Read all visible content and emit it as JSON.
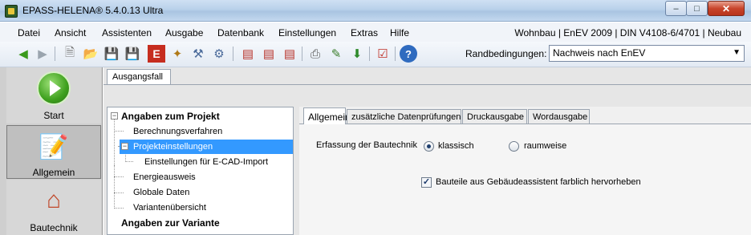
{
  "window": {
    "title": "EPASS-HELENA® 5.4.0.13 Ultra"
  },
  "menu": {
    "items": [
      "Datei",
      "Ansicht",
      "Assistenten",
      "Ausgabe",
      "Datenbank",
      "Einstellungen",
      "Extras",
      "Hilfe"
    ],
    "right_info": "Wohnbau | EnEV 2009 | DIN V4108-6/4701 | Neubau"
  },
  "toolbar": {
    "icons": [
      "back-arrow-icon",
      "forward-arrow-icon",
      "new-document-icon",
      "open-folder-icon",
      "save-icon",
      "save-as-icon",
      "energieausweis-e-icon",
      "wand-icon",
      "tool-icon",
      "gear-icon",
      "chart-icon",
      "chart-edit-icon",
      "chart-bar-icon",
      "print-icon",
      "edit-icon",
      "export-icon",
      "checklist-icon",
      "help-icon"
    ],
    "randbedingungen_label": "Randbedingungen:",
    "randbedingungen_value": "Nachweis nach EnEV"
  },
  "leftnav": {
    "items": [
      {
        "label": "Start",
        "icon": "start-play-icon"
      },
      {
        "label": "Allgemein",
        "icon": "notepad-icon"
      },
      {
        "label": "Bautechnik",
        "icon": "house-icon"
      }
    ]
  },
  "main": {
    "top_tab": "Ausgangsfall",
    "tree": {
      "items": [
        {
          "label": "Angaben zum Projekt",
          "bold": true,
          "expanded": true
        },
        {
          "label": "Berechnungsverfahren"
        },
        {
          "label": "Projekteinstellungen",
          "selected": true,
          "expanded": true
        },
        {
          "label": "Einstellungen für E-CAD-Import"
        },
        {
          "label": "Energieausweis"
        },
        {
          "label": "Globale Daten"
        },
        {
          "label": "Variantenübersicht"
        },
        {
          "label": "Angaben zur Variante",
          "bold": true
        }
      ]
    },
    "panel": {
      "tabs": [
        "Allgemein",
        "zusätzliche Datenprüfungen",
        "Druckausgabe",
        "Wordausgabe"
      ],
      "active_tab": "Allgemein",
      "erfassung_label": "Erfassung der Bautechnik",
      "radio_options": [
        {
          "label": "klassisch",
          "checked": true
        },
        {
          "label": "raumweise",
          "checked": false
        }
      ],
      "checkbox": {
        "label": "Bauteile aus Gebäudeassistent farblich hervorheben",
        "checked": true
      }
    }
  }
}
